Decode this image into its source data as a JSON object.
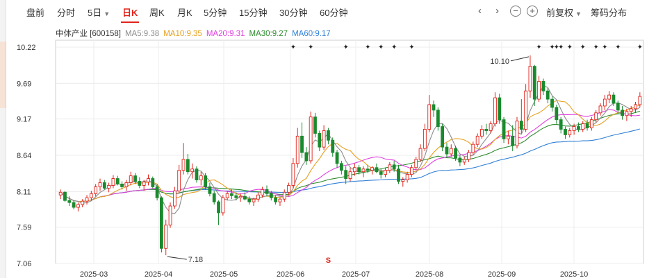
{
  "toolbar": {
    "items": [
      "盘前",
      "分时",
      "5日",
      "日K",
      "周K",
      "月K",
      "5分钟",
      "15分钟",
      "30分钟",
      "60分钟"
    ],
    "active": "日K",
    "fuquan": "前复权",
    "chips": "筹码分布"
  },
  "legend": {
    "stock": "中体产业 [600158]",
    "ma5": "MA5:9.38",
    "ma10": "MA10:9.35",
    "ma20": "MA20:9.31",
    "ma30": "MA30:9.27",
    "ma60": "MA60:9.17"
  },
  "colors": {
    "up": "#e2231a",
    "down": "#1a8a2e",
    "ma5": "#8c8c8c",
    "ma10": "#e6a020",
    "ma20": "#e040e0",
    "ma30": "#2e8b2e",
    "ma60": "#2f7fd6"
  },
  "chart_data": {
    "type": "candlestick",
    "ylim": [
      7.06,
      10.22
    ],
    "y_ticks": [
      10.22,
      9.69,
      9.17,
      8.64,
      8.11,
      7.59,
      7.06
    ],
    "x_ticks": [
      "2025-03",
      "2025-04",
      "2025-05",
      "2025-06",
      "2025-07",
      "2025-08",
      "2025-09",
      "2025-10"
    ],
    "high_label": "10.10",
    "low_label": "7.18",
    "marker": "S",
    "ohlc": [
      [
        8.06,
        8.14,
        8.0,
        8.1
      ],
      [
        8.1,
        8.12,
        7.96,
        7.98
      ],
      [
        7.98,
        8.04,
        7.9,
        7.95
      ],
      [
        7.95,
        7.98,
        7.85,
        7.88
      ],
      [
        7.88,
        7.95,
        7.82,
        7.92
      ],
      [
        7.92,
        8.0,
        7.88,
        7.97
      ],
      [
        7.97,
        8.06,
        7.92,
        8.02
      ],
      [
        8.02,
        8.12,
        7.98,
        8.08
      ],
      [
        8.08,
        8.22,
        8.04,
        8.18
      ],
      [
        8.18,
        8.3,
        8.12,
        8.24
      ],
      [
        8.24,
        8.28,
        8.14,
        8.16
      ],
      [
        8.16,
        8.24,
        8.1,
        8.2
      ],
      [
        8.2,
        8.35,
        8.16,
        8.3
      ],
      [
        8.3,
        8.34,
        8.2,
        8.22
      ],
      [
        8.22,
        8.26,
        8.14,
        8.18
      ],
      [
        8.18,
        8.28,
        8.12,
        8.24
      ],
      [
        8.24,
        8.4,
        8.2,
        8.34
      ],
      [
        8.34,
        8.38,
        8.22,
        8.26
      ],
      [
        8.26,
        8.32,
        8.16,
        8.2
      ],
      [
        8.2,
        8.28,
        8.12,
        8.25
      ],
      [
        8.25,
        8.36,
        8.2,
        8.3
      ],
      [
        8.3,
        8.33,
        8.16,
        8.18
      ],
      [
        8.18,
        8.22,
        7.98,
        8.02
      ],
      [
        8.02,
        8.04,
        7.22,
        7.28
      ],
      [
        7.28,
        7.7,
        7.18,
        7.62
      ],
      [
        7.62,
        7.95,
        7.58,
        7.9
      ],
      [
        7.9,
        8.18,
        7.86,
        8.12
      ],
      [
        8.12,
        8.5,
        8.08,
        8.42
      ],
      [
        8.42,
        8.82,
        8.36,
        8.58
      ],
      [
        8.58,
        8.66,
        8.36,
        8.4
      ],
      [
        8.4,
        8.52,
        8.3,
        8.44
      ],
      [
        8.44,
        8.48,
        8.24,
        8.28
      ],
      [
        8.28,
        8.4,
        8.2,
        8.34
      ],
      [
        8.34,
        8.38,
        8.14,
        8.18
      ],
      [
        8.18,
        8.24,
        8.04,
        8.08
      ],
      [
        8.08,
        8.12,
        7.92,
        7.96
      ],
      [
        7.96,
        7.98,
        7.62,
        7.8
      ],
      [
        7.8,
        8.06,
        7.76,
        8.02
      ],
      [
        8.02,
        8.12,
        7.98,
        8.08
      ],
      [
        8.08,
        8.14,
        8.0,
        8.05
      ],
      [
        8.05,
        8.1,
        7.98,
        8.02
      ],
      [
        8.02,
        8.08,
        7.96,
        8.04
      ],
      [
        8.04,
        8.1,
        7.98,
        8.0
      ],
      [
        8.0,
        8.04,
        7.92,
        7.96
      ],
      [
        7.96,
        8.02,
        7.9,
        8.0
      ],
      [
        8.0,
        8.1,
        7.96,
        8.06
      ],
      [
        8.06,
        8.18,
        8.02,
        8.14
      ],
      [
        8.14,
        8.2,
        8.04,
        8.08
      ],
      [
        8.08,
        8.12,
        7.98,
        8.02
      ],
      [
        8.02,
        8.06,
        7.92,
        7.96
      ],
      [
        7.96,
        8.02,
        7.9,
        8.0
      ],
      [
        8.0,
        8.14,
        7.96,
        8.1
      ],
      [
        8.1,
        8.24,
        8.06,
        8.2
      ],
      [
        8.2,
        8.6,
        8.16,
        8.52
      ],
      [
        8.52,
        9.04,
        8.46,
        8.92
      ],
      [
        8.92,
        9.12,
        8.6,
        8.68
      ],
      [
        8.68,
        8.76,
        8.5,
        8.56
      ],
      [
        8.56,
        9.28,
        8.52,
        9.2
      ],
      [
        9.2,
        9.26,
        8.9,
        8.96
      ],
      [
        8.96,
        9.0,
        8.7,
        8.76
      ],
      [
        8.76,
        9.08,
        8.72,
        9.0
      ],
      [
        9.0,
        9.04,
        8.8,
        8.86
      ],
      [
        8.86,
        8.9,
        8.62,
        8.68
      ],
      [
        8.68,
        8.72,
        8.46,
        8.52
      ],
      [
        8.52,
        8.56,
        8.36,
        8.42
      ],
      [
        8.42,
        8.48,
        8.22,
        8.3
      ],
      [
        8.3,
        8.46,
        8.26,
        8.4
      ],
      [
        8.4,
        8.52,
        8.34,
        8.46
      ],
      [
        8.46,
        8.5,
        8.36,
        8.4
      ],
      [
        8.4,
        8.48,
        8.32,
        8.44
      ],
      [
        8.44,
        8.5,
        8.38,
        8.42
      ],
      [
        8.42,
        8.48,
        8.36,
        8.46
      ],
      [
        8.46,
        8.52,
        8.38,
        8.4
      ],
      [
        8.4,
        8.44,
        8.3,
        8.36
      ],
      [
        8.36,
        8.46,
        8.32,
        8.42
      ],
      [
        8.42,
        8.54,
        8.38,
        8.5
      ],
      [
        8.5,
        8.56,
        8.4,
        8.44
      ],
      [
        8.44,
        8.5,
        8.22,
        8.26
      ],
      [
        8.26,
        8.32,
        8.18,
        8.28
      ],
      [
        8.28,
        8.4,
        8.24,
        8.36
      ],
      [
        8.36,
        8.5,
        8.32,
        8.46
      ],
      [
        8.46,
        8.62,
        8.42,
        8.58
      ],
      [
        8.58,
        8.8,
        8.54,
        8.74
      ],
      [
        8.74,
        9.1,
        8.7,
        9.02
      ],
      [
        9.02,
        9.52,
        8.98,
        9.38
      ],
      [
        9.38,
        9.44,
        9.2,
        9.3
      ],
      [
        9.3,
        9.34,
        9.0,
        9.06
      ],
      [
        9.06,
        9.1,
        8.7,
        8.76
      ],
      [
        8.76,
        8.82,
        8.6,
        8.66
      ],
      [
        8.66,
        8.8,
        8.62,
        8.74
      ],
      [
        8.74,
        8.78,
        8.56,
        8.6
      ],
      [
        8.6,
        8.64,
        8.48,
        8.54
      ],
      [
        8.54,
        8.62,
        8.5,
        8.58
      ],
      [
        8.58,
        8.72,
        8.54,
        8.68
      ],
      [
        8.68,
        8.84,
        8.64,
        8.8
      ],
      [
        8.8,
        8.96,
        8.76,
        8.92
      ],
      [
        8.92,
        9.08,
        8.88,
        9.02
      ],
      [
        9.02,
        9.1,
        8.94,
        9.0
      ],
      [
        9.0,
        9.14,
        8.96,
        9.1
      ],
      [
        9.1,
        9.56,
        9.06,
        9.48
      ],
      [
        9.48,
        9.54,
        9.1,
        9.16
      ],
      [
        9.16,
        9.2,
        8.82,
        8.88
      ],
      [
        8.88,
        9.0,
        8.8,
        8.92
      ],
      [
        8.92,
        9.08,
        8.7,
        8.78
      ],
      [
        8.78,
        9.2,
        8.74,
        9.14
      ],
      [
        9.14,
        9.46,
        8.96,
        9.02
      ],
      [
        9.02,
        9.68,
        8.98,
        9.58
      ],
      [
        9.58,
        10.1,
        9.48,
        9.94
      ],
      [
        9.94,
        9.96,
        9.36,
        9.46
      ],
      [
        9.46,
        9.8,
        9.42,
        9.72
      ],
      [
        9.72,
        9.76,
        9.52,
        9.58
      ],
      [
        9.58,
        9.62,
        9.4,
        9.46
      ],
      [
        9.46,
        9.5,
        9.28,
        9.34
      ],
      [
        9.34,
        9.38,
        9.1,
        9.16
      ],
      [
        9.16,
        9.2,
        8.96,
        9.02
      ],
      [
        9.02,
        9.06,
        8.88,
        8.94
      ],
      [
        8.94,
        9.04,
        8.9,
        9.0
      ],
      [
        9.0,
        9.1,
        8.94,
        9.06
      ],
      [
        9.06,
        9.12,
        8.98,
        9.02
      ],
      [
        9.02,
        9.14,
        8.98,
        9.1
      ],
      [
        9.1,
        9.16,
        9.0,
        9.04
      ],
      [
        9.04,
        9.2,
        9.0,
        9.16
      ],
      [
        9.16,
        9.3,
        9.12,
        9.26
      ],
      [
        9.26,
        9.4,
        9.22,
        9.36
      ],
      [
        9.36,
        9.52,
        9.3,
        9.46
      ],
      [
        9.46,
        9.58,
        9.4,
        9.52
      ],
      [
        9.52,
        9.56,
        9.36,
        9.4
      ],
      [
        9.4,
        9.44,
        9.24,
        9.3
      ],
      [
        9.3,
        9.36,
        9.16,
        9.22
      ],
      [
        9.22,
        9.32,
        9.14,
        9.28
      ],
      [
        9.28,
        9.36,
        9.2,
        9.32
      ],
      [
        9.32,
        9.42,
        9.26,
        9.38
      ],
      [
        9.38,
        9.56,
        9.34,
        9.5
      ]
    ]
  }
}
